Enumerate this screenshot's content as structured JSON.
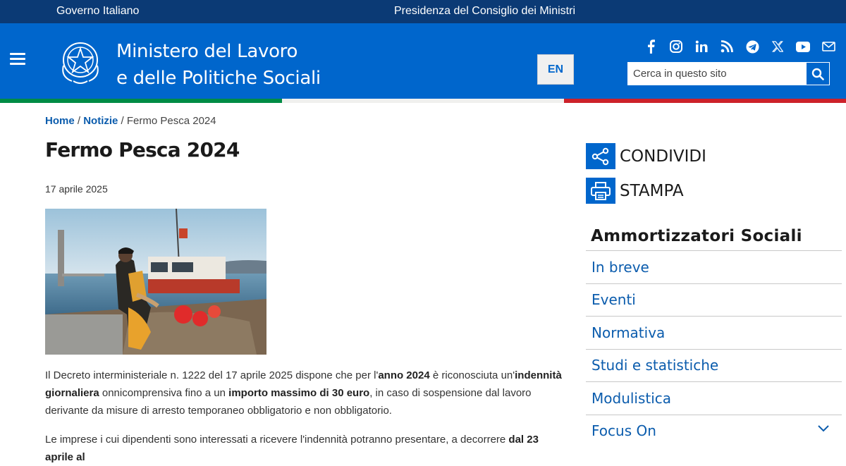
{
  "topbar": {
    "left_label": "Governo Italiano",
    "center_label": "Presidenza del Consiglio dei Ministri"
  },
  "header": {
    "title_line1": "Ministero del Lavoro",
    "title_line2": "e delle Politiche Sociali",
    "lang_button": "EN",
    "search_placeholder": "Cerca in questo sito",
    "social_icons": [
      "facebook-icon",
      "instagram-icon",
      "linkedin-icon",
      "rss-icon",
      "telegram-icon",
      "x-icon",
      "youtube-icon",
      "email-icon"
    ],
    "colors": {
      "topbar": "#0b3a75",
      "header": "#0066cc",
      "flag_green": "#008c45",
      "flag_white": "#f4f5f0",
      "flag_red": "#cd212a"
    }
  },
  "breadcrumb": {
    "home": "Home",
    "sep1": " / ",
    "news": "Notizie",
    "sep2": " / ",
    "current": "Fermo Pesca 2024"
  },
  "article": {
    "title": "Fermo Pesca 2024",
    "date": "17 aprile 2025",
    "p1": {
      "t1": "Il Decreto interministeriale n. 1222 del 17 aprile 2025 dispone che per l'",
      "b1": "anno 2024",
      "t2": " è riconosciuta un'",
      "b2": "indennità giornaliera",
      "t3": " onnicomprensiva fino a un ",
      "b3": "importo massimo di 30 euro",
      "t4": ", in caso di sospensione dal lavoro derivante da misure di arresto temporaneo obbligatorio e non obbligatorio."
    },
    "p2": {
      "t1": "Le imprese i cui dipendenti sono interessati a ricevere l'indennità potranno presentare, a decorrere ",
      "b1": "dal 23 aprile al"
    }
  },
  "actions": {
    "share": "CONDIVIDI",
    "print": "STAMPA"
  },
  "sidebar": {
    "title": "Ammortizzatori Sociali",
    "items": [
      {
        "label": "In breve"
      },
      {
        "label": "Eventi"
      },
      {
        "label": "Normativa"
      },
      {
        "label": "Studi e statistiche"
      },
      {
        "label": "Modulistica"
      },
      {
        "label": "Focus On",
        "expandable": true
      }
    ]
  }
}
